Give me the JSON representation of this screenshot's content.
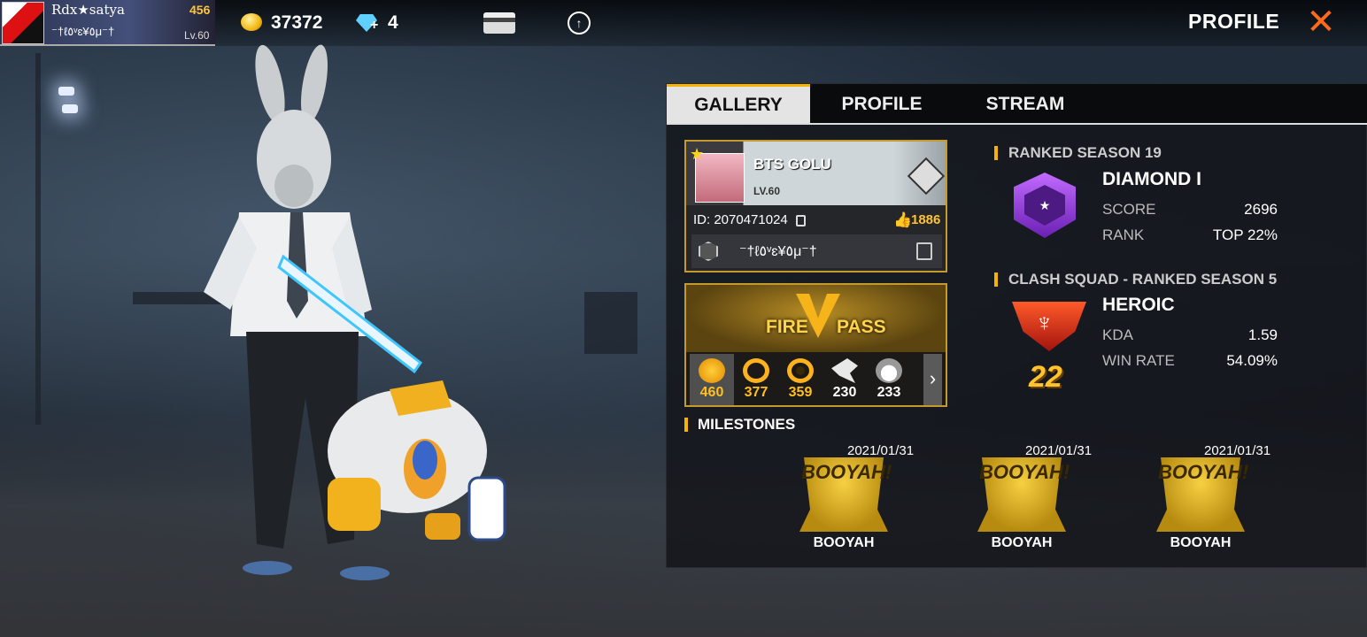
{
  "topbar": {
    "player_name": "Rdx★satya",
    "player_signature": "⁻†ℓ٥ᵛɛ¥٥μ⁻†",
    "player_badge_value": "456",
    "player_level": "Lv.60",
    "coins": "37372",
    "diamonds": "4",
    "page_title": "PROFILE",
    "close_label": "✕"
  },
  "tabs": [
    {
      "label": "GALLERY",
      "active": true
    },
    {
      "label": "PROFILE",
      "active": false
    },
    {
      "label": "STREAM",
      "active": false
    }
  ],
  "card": {
    "name": "BTS GOLU",
    "level": "LV.60",
    "id_text": "ID: 2070471024",
    "likes": "1886",
    "signature": "⁻†ℓ٥ᵛɛ¥٥μ⁻†"
  },
  "fire_pass": {
    "label_left": "FIRE",
    "label_right": "PASS",
    "items": [
      {
        "value": "460",
        "icon": "skull-icon",
        "color": "#ffb21e"
      },
      {
        "value": "377",
        "icon": "swirl-icon",
        "color": "#ffb21e"
      },
      {
        "value": "359",
        "icon": "ring-icon",
        "color": "#ffb21e"
      },
      {
        "value": "230",
        "icon": "eagle-icon",
        "color": "#ffffff"
      },
      {
        "value": "233",
        "icon": "demon-icon",
        "color": "#ffffff"
      }
    ]
  },
  "ranked_br": {
    "title": "RANKED SEASON 19",
    "rank_name": "DIAMOND I",
    "stats": [
      {
        "label": "SCORE",
        "value": "2696"
      },
      {
        "label": "RANK",
        "value": "TOP 22%"
      }
    ]
  },
  "ranked_cs": {
    "title": "CLASH SQUAD - RANKED SEASON 5",
    "rank_name": "HEROIC",
    "number": "22",
    "stats": [
      {
        "label": "KDA",
        "value": "1.59"
      },
      {
        "label": "WIN RATE",
        "value": "54.09%"
      }
    ]
  },
  "milestones": {
    "title": "MILESTONES",
    "items": [
      {
        "date": "2021/01/31",
        "label": "BOOYAH",
        "badge_text": "BOOYAH!"
      },
      {
        "date": "2021/01/31",
        "label": "BOOYAH",
        "badge_text": "BOOYAH!"
      },
      {
        "date": "2021/01/31",
        "label": "BOOYAH",
        "badge_text": "BOOYAH!"
      }
    ]
  },
  "colors": {
    "accent": "#f4b400",
    "close": "#ff6a1a",
    "gold": "#ffc42c"
  }
}
